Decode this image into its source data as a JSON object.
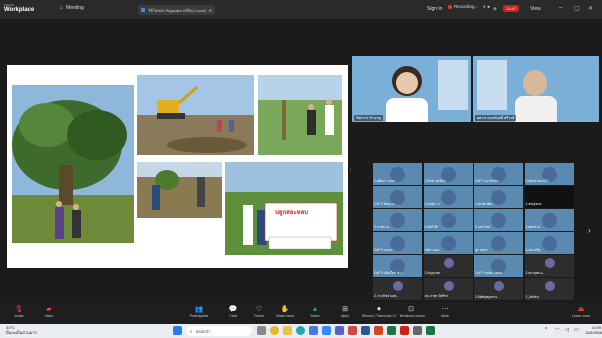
{
  "app": {
    "brand_top": "zoom",
    "brand_bottom": "Workplace"
  },
  "topbar": {
    "meeting_label": "Meeting",
    "window_title": "วิดีโอของ Rigacara เตรียม Location",
    "sign_in": "Sign in",
    "recording_label": "Recording...",
    "timer": "12:47",
    "view_label": "View"
  },
  "speakers": [
    {
      "name": "วิทยากร ชำนาญ"
    },
    {
      "name": "ผศ.ดร.ณรงค์ฤทธิ์ ศรีวงษ์"
    }
  ],
  "gallery": [
    {
      "name": "2-ศศินภา รมจา"
    },
    {
      "name": "2-ศิรพร ศุภมิตร"
    },
    {
      "name": "CoP 2 มอ.ทักษิณ"
    },
    {
      "name": "2-สุพจน์ สองแก้ว"
    },
    {
      "name": "CoP 2 พัทลุง อ..."
    },
    {
      "name": "2-กุลสุภา ก"
    },
    {
      "name": "2-ศุภชัย พัฒ..."
    },
    {
      "name": "2-ธนัญชนก"
    },
    {
      "name": "2-มานัส จง"
    },
    {
      "name": "2-พัชรี สีส"
    },
    {
      "name": "2-จุฑารัตน์"
    },
    {
      "name": "2-สุพจน์ ณ"
    },
    {
      "name": "CoP 2 ระยอง"
    },
    {
      "name": "ชนิตา ทอง"
    },
    {
      "name": "ลูก อนุชา"
    },
    {
      "name": "2-ประเสริฐ"
    },
    {
      "name": "CoP 2 เชียงใหม่ ชำ..."
    },
    {
      "name": "2-กัญญาพร"
    },
    {
      "name": "CoP 2 ชุมพร Jawor"
    },
    {
      "name": "2-ศรายุทธ อ..."
    },
    {
      "name": "2-วรวณิชย์ มลพ..."
    },
    {
      "name": "ประภาพร มีศรีทร"
    },
    {
      "name": "2-Mattiyaporn s..."
    },
    {
      "name": "2_Arthit.s"
    }
  ],
  "slide": {
    "banner_text": "ปลูกสละหลบ"
  },
  "toolbar": {
    "audio": "Audio",
    "video": "Video",
    "participants": "Participants",
    "chat": "Chat",
    "react": "React",
    "raise_hand": "Raise hand",
    "share": "Share",
    "apps": "Apps",
    "record": "Record | Transcript Cloud Recording",
    "breakout": "Breakout rooms",
    "more": "More",
    "leave": "Leave room"
  },
  "taskbar": {
    "search_placeholder": "Search",
    "weather_temp": "33°C",
    "weather_desc": "มีเมฆเป็นส่วนมาก",
    "time": "14:09",
    "date": "13/8/2568"
  }
}
